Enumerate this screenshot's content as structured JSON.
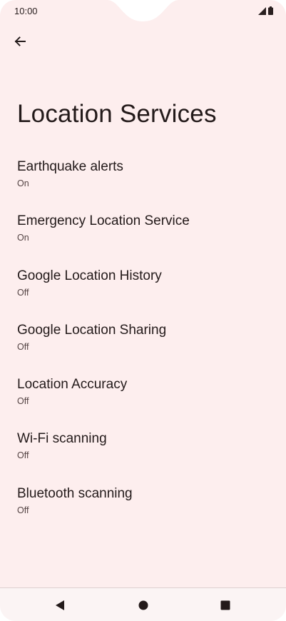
{
  "status_bar": {
    "time": "10:00",
    "signal_icon": "signal-icon",
    "battery_icon": "battery-icon"
  },
  "header": {
    "back_icon": "back-arrow-icon",
    "title": "Location Services"
  },
  "settings": {
    "items": [
      {
        "title": "Earthquake alerts",
        "summary": "On"
      },
      {
        "title": "Emergency Location Service",
        "summary": "On"
      },
      {
        "title": "Google Location History",
        "summary": "Off"
      },
      {
        "title": "Google Location Sharing",
        "summary": "Off"
      },
      {
        "title": "Location Accuracy",
        "summary": "Off"
      },
      {
        "title": "Wi-Fi scanning",
        "summary": "Off"
      },
      {
        "title": "Bluetooth scanning",
        "summary": "Off"
      }
    ]
  },
  "nav_bar": {
    "back_icon": "nav-back-icon",
    "home_icon": "nav-home-icon",
    "recents_icon": "nav-recents-icon"
  },
  "colors": {
    "background": "#fdeeee",
    "text_primary": "#231a1a",
    "text_secondary": "#534343"
  }
}
